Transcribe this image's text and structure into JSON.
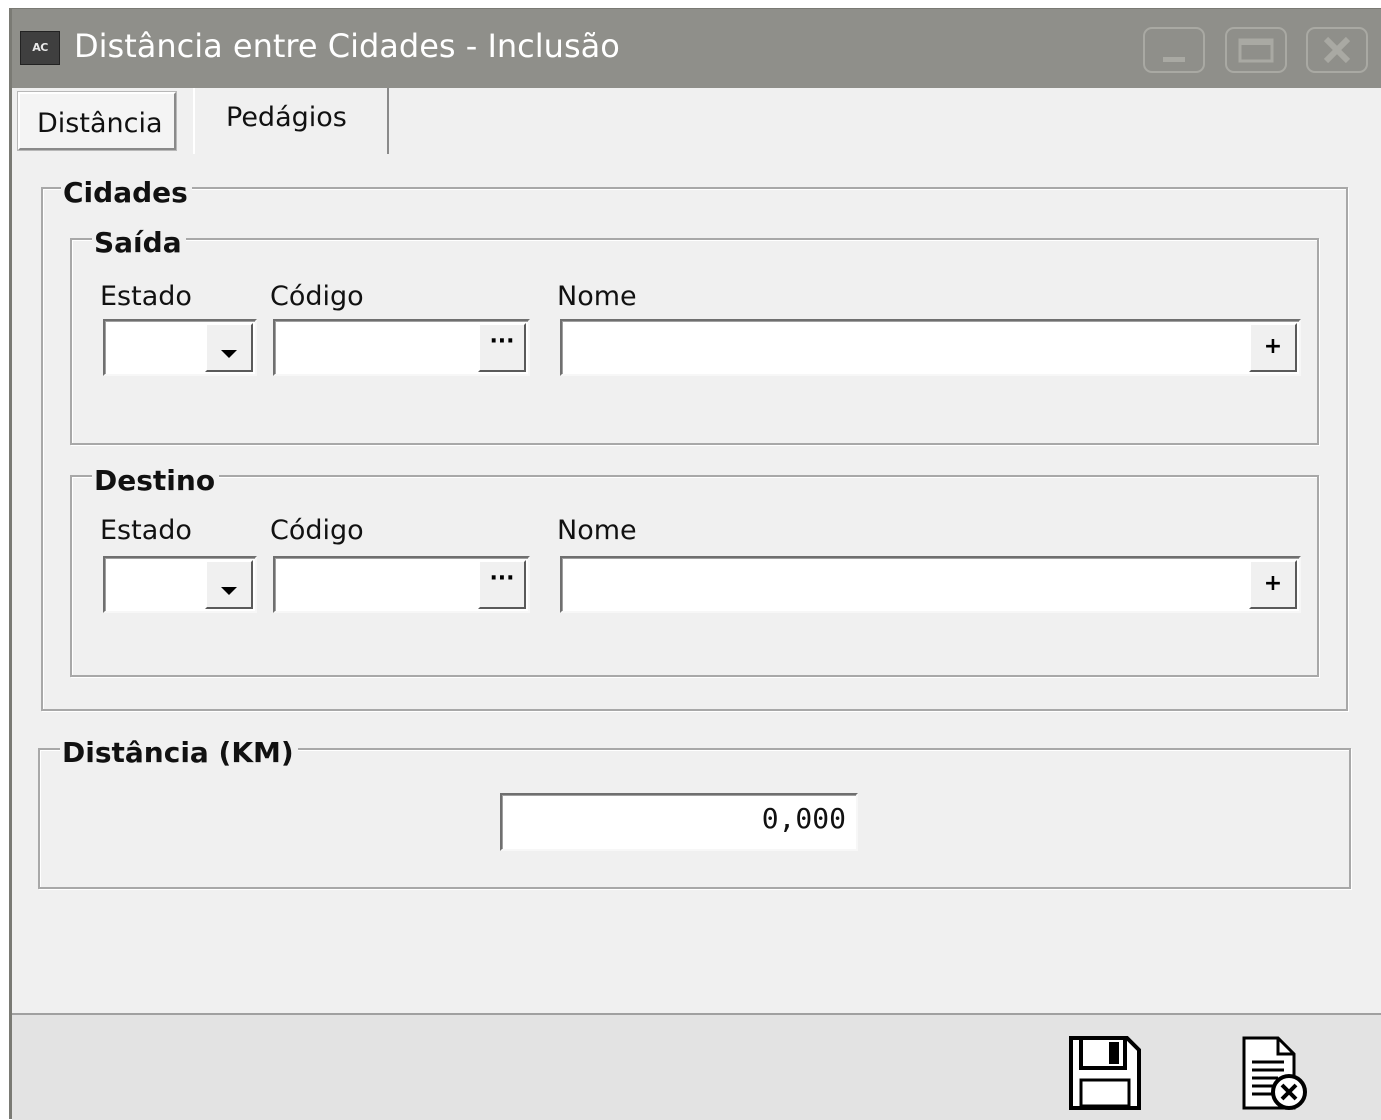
{
  "window": {
    "app_badge": "AC",
    "title": "Distância entre Cidades - Inclusão"
  },
  "tabs": [
    "Distância",
    "Pedágios"
  ],
  "cidades": {
    "legend": "Cidades",
    "saida": {
      "legend": "Saída",
      "estado_label": "Estado",
      "codigo_label": "Código",
      "nome_label": "Nome",
      "estado_value": "",
      "codigo_value": "",
      "nome_value": ""
    },
    "destino": {
      "legend": "Destino",
      "estado_label": "Estado",
      "codigo_label": "Código",
      "nome_label": "Nome",
      "estado_value": "",
      "codigo_value": "",
      "nome_value": ""
    }
  },
  "distancia": {
    "legend": "Distância (KM)",
    "value": "0,000"
  },
  "buttons": {
    "lookup_glyph": "···",
    "add_glyph": "+"
  },
  "icons": {
    "save": "floppy-disk-icon",
    "cancel": "document-cancel-icon",
    "dropdown": "triangle-down-icon"
  }
}
